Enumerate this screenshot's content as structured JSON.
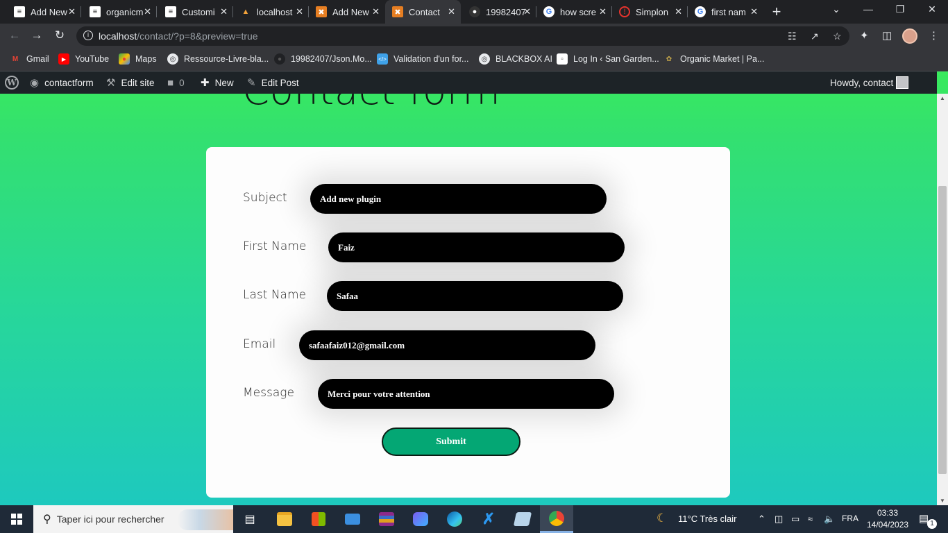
{
  "browser": {
    "tabs": [
      {
        "title": "Add New",
        "icon": "wp-icon",
        "active": false
      },
      {
        "title": "organicm",
        "icon": "wp-icon",
        "active": false
      },
      {
        "title": "Customi",
        "icon": "wp-icon",
        "active": false
      },
      {
        "title": "localhost",
        "icon": "xampp-icon",
        "active": false
      },
      {
        "title": "Add New",
        "icon": "xampp-icon",
        "active": false
      },
      {
        "title": "Contact",
        "icon": "xampp-icon",
        "active": true
      },
      {
        "title": "19982407",
        "icon": "github-icon",
        "active": false
      },
      {
        "title": "how scre",
        "icon": "google-icon",
        "active": false
      },
      {
        "title": "Simplon",
        "icon": "simplon-icon",
        "active": false
      },
      {
        "title": "first nam",
        "icon": "google-icon",
        "active": false
      }
    ],
    "new_tab_symbol": "+",
    "url_host": "localhost",
    "url_path": "/contact/?p=8&preview=true",
    "bookmarks": [
      {
        "label": "Gmail",
        "icon": "gmail-icon"
      },
      {
        "label": "YouTube",
        "icon": "youtube-icon"
      },
      {
        "label": "Maps",
        "icon": "maps-icon"
      },
      {
        "label": "Ressource-Livre-bla...",
        "icon": "globe-icon"
      },
      {
        "label": "19982407/Json.Mo...",
        "icon": "github-icon"
      },
      {
        "label": "Validation d'un for...",
        "icon": "code-icon"
      },
      {
        "label": "BLACKBOX AI",
        "icon": "globe-icon"
      },
      {
        "label": "Log In ‹ San Garden...",
        "icon": "page-icon"
      },
      {
        "label": "Organic Market | Pa...",
        "icon": "leaf-icon"
      }
    ]
  },
  "adminbar": {
    "site_name": "contactform",
    "edit_site": "Edit site",
    "comments_count": "0",
    "new_label": "New",
    "edit_post": "Edit Post",
    "howdy": "Howdy, contact"
  },
  "page": {
    "title": "Contact form",
    "fields": [
      {
        "label": "Subject",
        "value": "Add new plugin"
      },
      {
        "label": "First Name",
        "value": "Faiz"
      },
      {
        "label": "Last Name",
        "value": "Safaa"
      },
      {
        "label": "Email",
        "value": "safaafaiz012@gmail.com"
      },
      {
        "label": "Message",
        "value": "Merci pour votre attention"
      }
    ],
    "submit_label": "Submit"
  },
  "taskbar": {
    "search_placeholder": "Taper ici pour rechercher",
    "weather": "11°C  Très clair",
    "language": "FRA",
    "time": "03:33",
    "date": "14/04/2023",
    "notification_count": "1"
  },
  "colors": {
    "page_gradient_top": "#39ea5d",
    "page_gradient_bottom": "#1ec9be",
    "submit_bg": "#04a774",
    "field_bg": "#000000",
    "adminbar_bg": "#1d2327"
  }
}
